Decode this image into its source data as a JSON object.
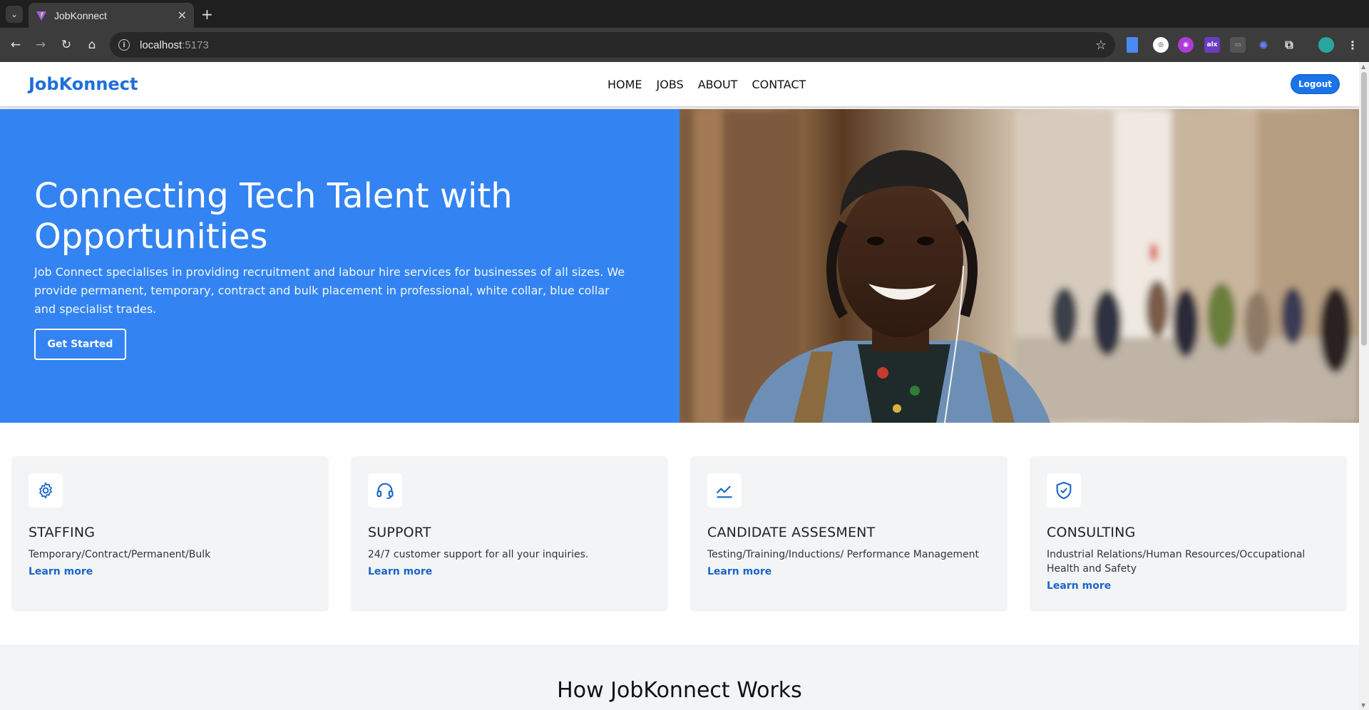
{
  "browser": {
    "tab_title": "JobKonnect",
    "url_host": "localhost",
    "url_port": ":5173"
  },
  "header": {
    "logo": "JobKonnect",
    "nav": [
      "HOME",
      "JOBS",
      "ABOUT",
      "CONTACT"
    ],
    "logout_label": "Logout"
  },
  "hero": {
    "title": "Connecting Tech Talent with Opportunities",
    "description": "Job Connect specialises in providing recruitment and labour hire services for businesses of all sizes. We provide permanent, temporary, contract and bulk placement in professional, white collar, blue collar and specialist trades.",
    "cta_label": "Get Started"
  },
  "services": [
    {
      "title": "STAFFING",
      "description": "Temporary/Contract/Permanent/Bulk",
      "link": "Learn more",
      "icon": "gear-icon"
    },
    {
      "title": "SUPPORT",
      "description": "24/7 customer support for all your inquiries.",
      "link": "Learn more",
      "icon": "headset-icon"
    },
    {
      "title": "CANDIDATE ASSESMENT",
      "description": "Testing/Training/Inductions/ Performance Management",
      "link": "Learn more",
      "icon": "chart-line-icon"
    },
    {
      "title": "CONSULTING",
      "description": "Industrial Relations/Human Resources/Occupational Health and Safety",
      "link": "Learn more",
      "icon": "shield-check-icon"
    }
  ],
  "how_it_works": {
    "title": "How JobKonnect Works"
  },
  "colors": {
    "brand": "#1e6fd9",
    "hero_bg": "#3384f2",
    "card_bg": "#f3f4f6",
    "link": "#1a65c9"
  }
}
